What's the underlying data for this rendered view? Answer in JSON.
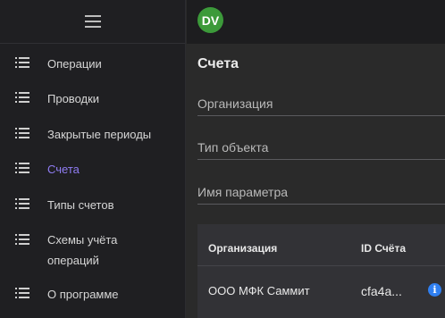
{
  "user": {
    "initials": "DV"
  },
  "colors": {
    "accent": "#8f7cf2",
    "avatar": "#3c9a3a",
    "info": "#2f7ff0"
  },
  "sidebar": {
    "menu_icon": "hamburger-menu-icon",
    "items": [
      {
        "label": "Операции",
        "icon": "list-icon",
        "active": false
      },
      {
        "label": "Проводки",
        "icon": "list-icon",
        "active": false
      },
      {
        "label": "Закрытые периоды",
        "icon": "list-icon",
        "active": false
      },
      {
        "label": "Счета",
        "icon": "list-icon",
        "active": true
      },
      {
        "label": "Типы счетов",
        "icon": "list-icon",
        "active": false
      },
      {
        "label": "Схемы учёта",
        "label2": "операций",
        "icon": "list-icon",
        "active": false
      },
      {
        "label": "О программе",
        "icon": "list-icon",
        "active": false
      }
    ]
  },
  "main": {
    "title": "Счета",
    "filters": {
      "organization": "Организация",
      "object_type": "Тип объекта",
      "param_name": "Имя параметра"
    },
    "table": {
      "columns": [
        "Организация",
        "ID Счёта"
      ],
      "rows": [
        {
          "organization": "ООО МФК Саммит",
          "account_id": "cfa4a..."
        }
      ]
    }
  }
}
